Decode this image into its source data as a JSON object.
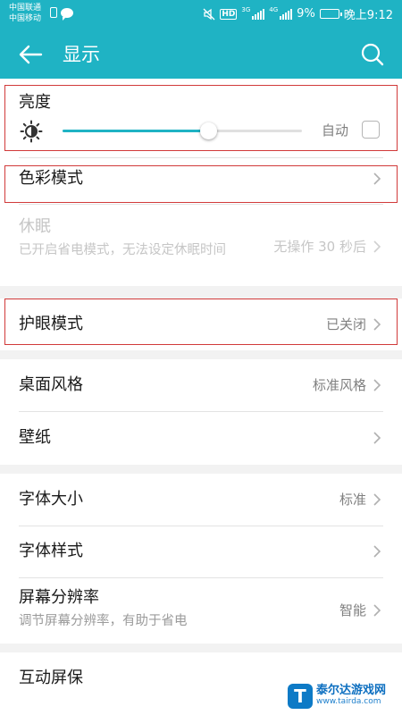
{
  "status_bar": {
    "carrier_1": "中国联通",
    "carrier_2": "中国移动",
    "hd": "HD",
    "net_1": "3G",
    "net_2": "4G",
    "battery": "9%",
    "time": "晚上9:12"
  },
  "toolbar": {
    "title": "显示",
    "accent": "#1fb3c4"
  },
  "brightness": {
    "label": "亮度",
    "level": 0.61,
    "auto_label": "自动",
    "auto_checked": false
  },
  "color_mode": {
    "label": "色彩模式"
  },
  "sleep": {
    "label": "休眠",
    "subtitle": "已开启省电模式，无法设定休眠时间",
    "value": "无操作 30 秒后",
    "disabled": true
  },
  "eye_comfort": {
    "label": "护眼模式",
    "value": "已关闭"
  },
  "desktop_style": {
    "label": "桌面风格",
    "value": "标准风格"
  },
  "wallpaper": {
    "label": "壁纸"
  },
  "font_size": {
    "label": "字体大小",
    "value": "标准"
  },
  "font_style": {
    "label": "字体样式"
  },
  "resolution": {
    "label": "屏幕分辨率",
    "subtitle": "调节屏幕分辨率，有助于省电",
    "value": "智能"
  },
  "screensaver": {
    "label": "互动屏保"
  },
  "highlight_color": "#d13a3a",
  "watermark": {
    "logo": "T",
    "name": "泰尔达游戏网",
    "url": "www.tairda.com"
  }
}
